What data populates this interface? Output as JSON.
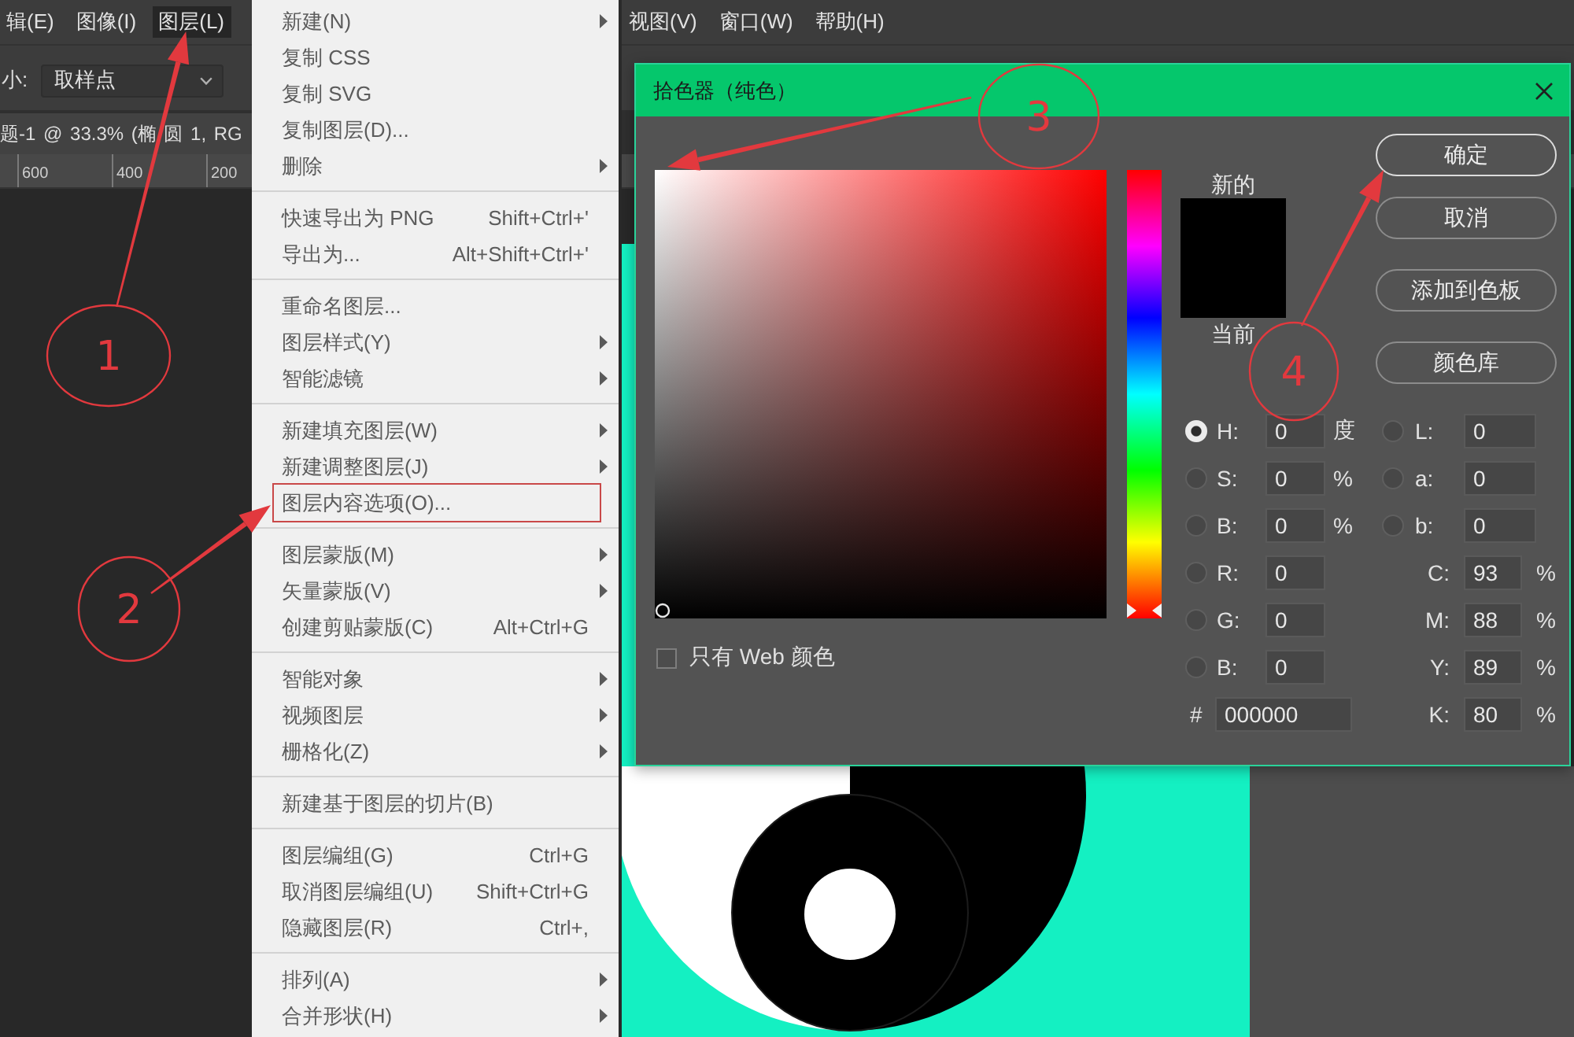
{
  "menu_bar": [
    {
      "label": "辑(E)",
      "selected": false
    },
    {
      "label": "图像(I)",
      "selected": false
    },
    {
      "label": "图层(L)",
      "selected": true
    },
    {
      "label": "视图(V)",
      "selected": false
    },
    {
      "label": "窗口(W)",
      "selected": false
    },
    {
      "label": "帮助(H)",
      "selected": false
    }
  ],
  "options_bar": {
    "label": "小:",
    "dropdown": "取样点"
  },
  "document_tab": "题-1 @ 33.3% (椭 圆 1, RG",
  "ruler": [
    "600",
    "400",
    "200"
  ],
  "layer_menu": [
    {
      "items": [
        {
          "label": "新建(N)",
          "submenu": true,
          "highlighted": false
        },
        {
          "label": "复制 CSS",
          "submenu": false,
          "highlighted": false
        },
        {
          "label": "复制 SVG",
          "submenu": false,
          "highlighted": false
        },
        {
          "label": "复制图层(D)...",
          "submenu": false,
          "highlighted": false
        },
        {
          "label": "删除",
          "submenu": true,
          "highlighted": false
        }
      ]
    },
    {
      "items": [
        {
          "label": "快速导出为 PNG",
          "shortcut": "Shift+Ctrl+'",
          "submenu": false,
          "highlighted": false
        },
        {
          "label": "导出为...",
          "shortcut": "Alt+Shift+Ctrl+'",
          "submenu": false,
          "highlighted": false
        }
      ]
    },
    {
      "items": [
        {
          "label": "重命名图层...",
          "submenu": false,
          "highlighted": false
        },
        {
          "label": "图层样式(Y)",
          "submenu": true,
          "highlighted": false
        },
        {
          "label": "智能滤镜",
          "submenu": true,
          "highlighted": false
        }
      ]
    },
    {
      "items": [
        {
          "label": "新建填充图层(W)",
          "submenu": true,
          "highlighted": false
        },
        {
          "label": "新建调整图层(J)",
          "submenu": true,
          "highlighted": false
        },
        {
          "label": "图层内容选项(O)...",
          "submenu": false,
          "highlighted": true
        }
      ]
    },
    {
      "items": [
        {
          "label": "图层蒙版(M)",
          "submenu": true,
          "highlighted": false
        },
        {
          "label": "矢量蒙版(V)",
          "submenu": true,
          "highlighted": false
        },
        {
          "label": "创建剪贴蒙版(C)",
          "shortcut": "Alt+Ctrl+G",
          "submenu": false,
          "highlighted": false
        }
      ]
    },
    {
      "items": [
        {
          "label": "智能对象",
          "submenu": true,
          "highlighted": false
        },
        {
          "label": "视频图层",
          "submenu": true,
          "highlighted": false
        },
        {
          "label": "栅格化(Z)",
          "submenu": true,
          "highlighted": false
        }
      ]
    },
    {
      "items": [
        {
          "label": "新建基于图层的切片(B)",
          "submenu": false,
          "highlighted": false
        }
      ]
    },
    {
      "items": [
        {
          "label": "图层编组(G)",
          "shortcut": "Ctrl+G",
          "submenu": false,
          "highlighted": false
        },
        {
          "label": "取消图层编组(U)",
          "shortcut": "Shift+Ctrl+G",
          "submenu": false,
          "highlighted": false
        },
        {
          "label": "隐藏图层(R)",
          "shortcut": "Ctrl+,",
          "submenu": false,
          "highlighted": false
        }
      ]
    },
    {
      "items": [
        {
          "label": "排列(A)",
          "submenu": true,
          "highlighted": false
        },
        {
          "label": "合并形状(H)",
          "submenu": true,
          "highlighted": false
        }
      ]
    }
  ],
  "color_picker": {
    "title": "拾色器（纯色）",
    "hue_slider": {
      "level": 0
    },
    "web_colors_only": {
      "label": "只有 Web 颜色",
      "checked": false
    },
    "swatches": [
      {
        "label": "新的",
        "color": "#000000"
      },
      {
        "label": "当前",
        "color": "#000000"
      }
    ],
    "buttons": [
      {
        "label": "确定",
        "default": true
      },
      {
        "label": "取消",
        "default": false
      },
      {
        "label": "添加到色板",
        "default": false
      },
      {
        "label": "颜色库",
        "default": false
      }
    ],
    "left_fields": [
      {
        "fields": [
          {
            "kind": "radio",
            "label": "H:",
            "value": "0",
            "unit": "度",
            "selected": true
          },
          {
            "kind": "radio",
            "label": "S:",
            "value": "0",
            "unit": "%",
            "selected": false
          },
          {
            "kind": "radio",
            "label": "B:",
            "value": "0",
            "unit": "%",
            "selected": false
          }
        ]
      },
      {
        "fields": [
          {
            "kind": "radio",
            "label": "R:",
            "value": "0",
            "selected": false
          },
          {
            "kind": "radio",
            "label": "G:",
            "value": "0",
            "selected": false
          },
          {
            "kind": "radio",
            "label": "B:",
            "value": "0",
            "selected": false
          }
        ]
      },
      {
        "fields": [
          {
            "kind": "hex",
            "label": "#",
            "value": "000000"
          }
        ]
      }
    ],
    "right_fields": [
      {
        "fields": [
          {
            "kind": "radio",
            "label": "L:",
            "value": "0",
            "selected": false
          },
          {
            "kind": "radio",
            "label": "a:",
            "value": "0",
            "selected": false
          },
          {
            "kind": "radio",
            "label": "b:",
            "value": "0",
            "selected": false
          }
        ]
      },
      {
        "fields": [
          {
            "kind": "plain",
            "label": "C:",
            "value": "93",
            "unit": "%"
          },
          {
            "kind": "plain",
            "label": "M:",
            "value": "88",
            "unit": "%"
          },
          {
            "kind": "plain",
            "label": "Y:",
            "value": "89",
            "unit": "%"
          },
          {
            "kind": "plain",
            "label": "K:",
            "value": "80",
            "unit": "%"
          }
        ]
      }
    ]
  },
  "annotations": [
    {
      "number": "1"
    },
    {
      "number": "2"
    },
    {
      "number": "3"
    },
    {
      "number": "4"
    }
  ]
}
